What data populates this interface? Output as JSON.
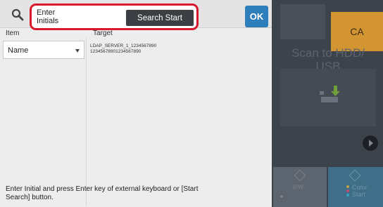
{
  "search": {
    "input_value": "Enter\nInitials",
    "button_label": "Search Start"
  },
  "ok_label": "OK",
  "columns": {
    "item": "Item",
    "target": "Target"
  },
  "item_select_value": "Name",
  "target_lines": [
    "LDAP_SERVER_1_1234567890",
    "12345678901234567890"
  ],
  "hint": "Enter Initial and press Enter key of external keyboard or [Start Search] button.",
  "background": {
    "ca_label": "CA",
    "scan_label": "Scan to HDD/ USB",
    "bw_label": "B/W",
    "color_label_1": "Color",
    "color_label_2": "Start"
  },
  "colors": {
    "highlight": "#d8182b",
    "ok": "#2e7ebc",
    "ca": "#d39531"
  }
}
